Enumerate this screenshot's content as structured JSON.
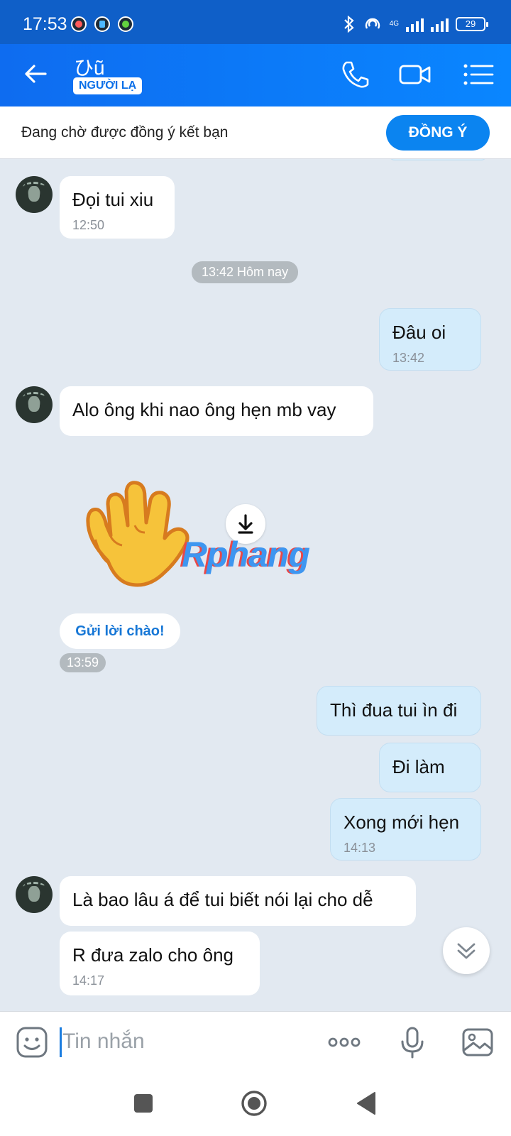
{
  "status_bar": {
    "time": "17:53",
    "network": "4G",
    "battery": "29"
  },
  "header": {
    "contact_name": "ひũ",
    "contact_badge": "NGƯỜI LẠ"
  },
  "friend_request": {
    "text": "Đang chờ được đồng ý kết bạn",
    "accept_label": "ĐỒNG Ý"
  },
  "messages": [
    {
      "side": "in",
      "text": "Đọi tui xiu",
      "time": "12:50"
    },
    {
      "side": "divider",
      "text": "13:42 Hôm nay"
    },
    {
      "side": "out",
      "text": "Đâu oi",
      "time": "13:42"
    },
    {
      "side": "in",
      "text": "Alo ông khi nao ông hẹn mb vay",
      "time": ""
    },
    {
      "side": "in",
      "type": "sticker",
      "sticker": "waving-hand",
      "watermark": "Rphang"
    },
    {
      "side": "in",
      "type": "action",
      "text": "Gửi lời chào!",
      "time": "13:59"
    },
    {
      "side": "out",
      "text": "Thì đua tui ìn đi",
      "time": ""
    },
    {
      "side": "out",
      "text": "Đi làm",
      "time": ""
    },
    {
      "side": "out",
      "text": "Xong mới hẹn",
      "time": "14:13"
    },
    {
      "side": "in",
      "text": "Là bao lâu á để tui biết nói lại cho dễ",
      "time": ""
    },
    {
      "side": "in",
      "text": "R đưa zalo cho ông",
      "time": "14:17"
    }
  ],
  "composer": {
    "placeholder": "Tin nhắn"
  },
  "icons": {
    "back": "back-arrow-icon",
    "call": "phone-icon",
    "video": "video-camera-icon",
    "menu": "list-menu-icon",
    "download": "download-icon",
    "scroll": "double-chevron-down-icon",
    "emoji": "emoji-icon",
    "more": "more-dots-icon",
    "mic": "microphone-icon",
    "image": "image-icon"
  },
  "colors": {
    "accent": "#0b84f0",
    "header_start": "#0e6cf0",
    "header_end": "#0a86ff",
    "outgoing_bubble": "#d4ecfb",
    "chat_background": "#e2e9f1"
  }
}
